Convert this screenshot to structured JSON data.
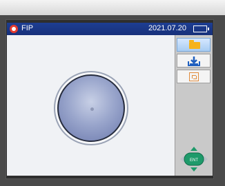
{
  "titlebar": {
    "app_title": "FIP",
    "datetime": "2021.07.20",
    "battery_level": 1.0,
    "colors": {
      "bar": "#1d3e93",
      "battery": "#3ddc2f",
      "app_icon": "#e53a2d"
    }
  },
  "viewport": {
    "image": "fiber-end-face"
  },
  "sidebar": {
    "buttons": [
      {
        "icon": "folder-icon",
        "selected": true
      },
      {
        "icon": "save-icon",
        "selected": false
      },
      {
        "icon": "frame-icon",
        "selected": false
      }
    ],
    "nav_pad": {
      "center_label": "ENT",
      "icon": "dpad-icon"
    }
  }
}
